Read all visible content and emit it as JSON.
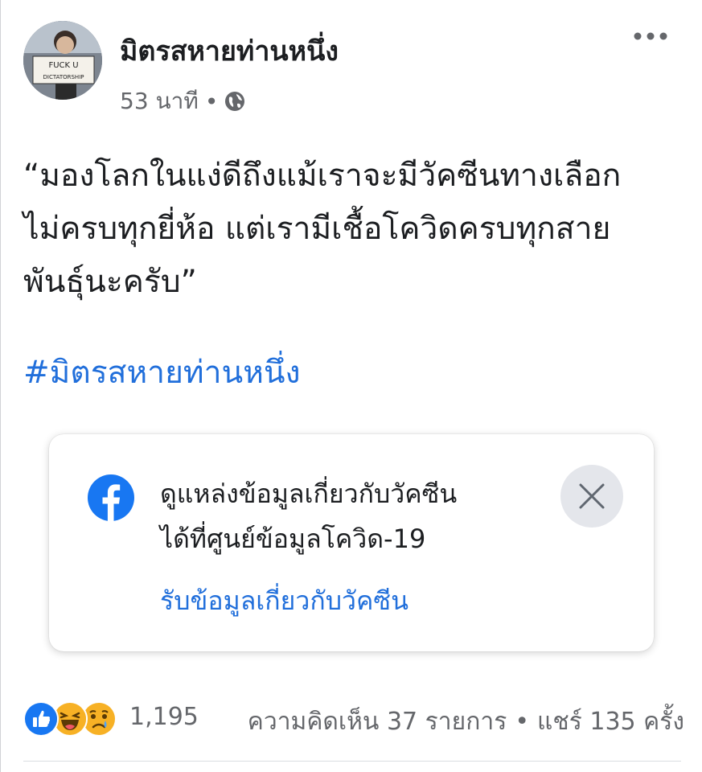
{
  "post": {
    "author": "มิตรสหายท่านหนึ่ง",
    "time": "53 นาที",
    "dot": "•",
    "privacy_icon": "globe-icon",
    "more_icon": "more-horizontal-icon",
    "avatar_sign_text": [
      "FUCK U",
      "DICTATORSHIP"
    ],
    "text_lines": [
      "“มองโลกในแง่ดีถึงแม้เราจะมีวัคซีนทางเลือก",
      "ไม่ครบทุกยี่ห้อ  แต่เรามีเชื้อโควิดครบทุกสาย",
      "พันธุ์นะครับ”"
    ],
    "hashtag": "#มิตรสหายท่านหนึ่ง"
  },
  "info_card": {
    "icon": "facebook-logo-icon",
    "text_lines": [
      "ดูแหล่งข้อมูลเกี่ยวกับวัคซีน",
      "ได้ที่ศูนย์ข้อมูลโควิด-19"
    ],
    "link_label": "รับข้อมูลเกี่ยวกับวัคซีน",
    "close_icon": "close-icon"
  },
  "footer": {
    "reactions": [
      "like-icon",
      "haha-icon",
      "sad-icon"
    ],
    "reaction_count": "1,195",
    "comments": "ความคิดเห็น 37 รายการ",
    "separator": "•",
    "shares": "แชร์ 135 ครั้ง"
  },
  "colors": {
    "link_blue": "#216fdb",
    "facebook_blue": "#1877f2",
    "secondary_text": "#65676b",
    "close_bg": "#e4e6eb"
  }
}
